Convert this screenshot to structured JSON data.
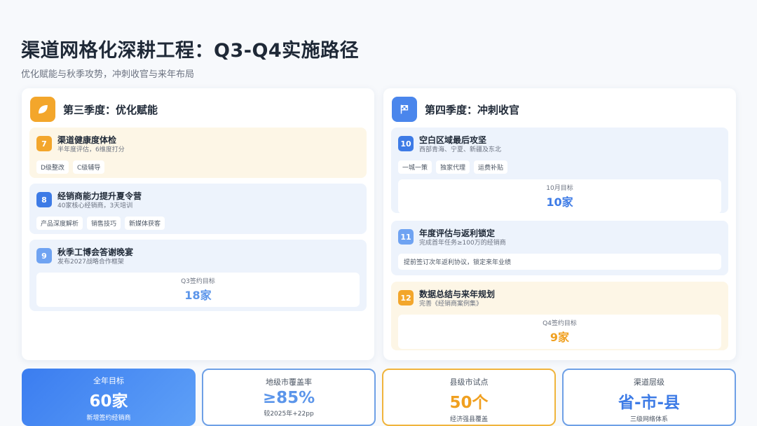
{
  "title": "渠道网格化深耕工程：Q3-Q4实施路径",
  "subtitle": "优化赋能与秋季攻势，冲刺收官与来年布局",
  "colors": {
    "accent_blue": "#3d7be6",
    "accent_orange": "#f3a62b",
    "light_blue": "#6fa3f2"
  },
  "q3": {
    "icon": "leaf-icon",
    "title": "第三季度：优化赋能",
    "items": [
      {
        "num": "7",
        "title": "渠道健康度体检",
        "desc": "半年度评估，6维度打分",
        "tags": [
          "D级整改",
          "C级辅导"
        ]
      },
      {
        "num": "8",
        "title": "经销商能力提升夏令营",
        "desc": "40家核心经销商，3天培训",
        "tags": [
          "产品深度解析",
          "销售技巧",
          "新媒体获客"
        ]
      },
      {
        "num": "9",
        "title": "秋季工博会答谢晚宴",
        "desc": "发布2027战略合作框架",
        "goal_label": "Q3签约目标",
        "goal_value": "18家"
      }
    ]
  },
  "q4": {
    "icon": "flag-icon",
    "title": "第四季度：冲刺收官",
    "items": [
      {
        "num": "10",
        "title": "空白区域最后攻坚",
        "desc": "西部青海、宁夏、新疆及东北",
        "tags": [
          "一城一策",
          "独家代理",
          "运费补贴"
        ],
        "goal_label": "10月目标",
        "goal_value": "10家"
      },
      {
        "num": "11",
        "title": "年度评估与返利锁定",
        "desc": "完成首年任务≥100万的经销商",
        "note": "提前签订次年返利协议，锁定来年业绩"
      },
      {
        "num": "12",
        "title": "数据总结与来年规划",
        "desc": "完善《经销商案例集》",
        "goal_label": "Q4签约目标",
        "goal_value": "9家"
      }
    ]
  },
  "stats": [
    {
      "label": "全年目标",
      "value": "60家",
      "note": "新增签约经销商"
    },
    {
      "label": "地级市覆盖率",
      "value": "≥85%",
      "note": "较2025年+22pp"
    },
    {
      "label": "县级市试点",
      "value": "50个",
      "note": "经济强县覆盖"
    },
    {
      "label": "渠道层级",
      "value": "省-市-县",
      "note": "三级网络体系"
    }
  ]
}
